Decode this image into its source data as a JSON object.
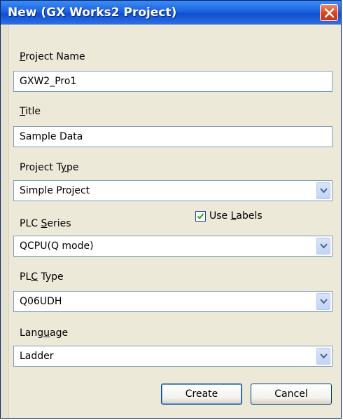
{
  "window": {
    "title": "New (GX Works2 Project)"
  },
  "fields": {
    "project_name": {
      "label": "Project Name",
      "value": "GXW2_Pro1"
    },
    "title": {
      "label": "Title",
      "value": "Sample Data"
    },
    "project_type": {
      "label": "Project Type",
      "value": "Simple Project"
    },
    "use_labels": {
      "label": "Use Labels",
      "checked": true
    },
    "plc_series": {
      "label": "PLC Series",
      "value": "QCPU(Q mode)"
    },
    "plc_type": {
      "label": "PLC Type",
      "value": "Q06UDH"
    },
    "language": {
      "label": "Language",
      "value": "Ladder"
    }
  },
  "buttons": {
    "create": "Create",
    "cancel": "Cancel"
  },
  "colors": {
    "titlebar": "#1d63e0",
    "close": "#d9431e",
    "input_border": "#7f9db9",
    "dialog_bg": "#ece9d8"
  }
}
